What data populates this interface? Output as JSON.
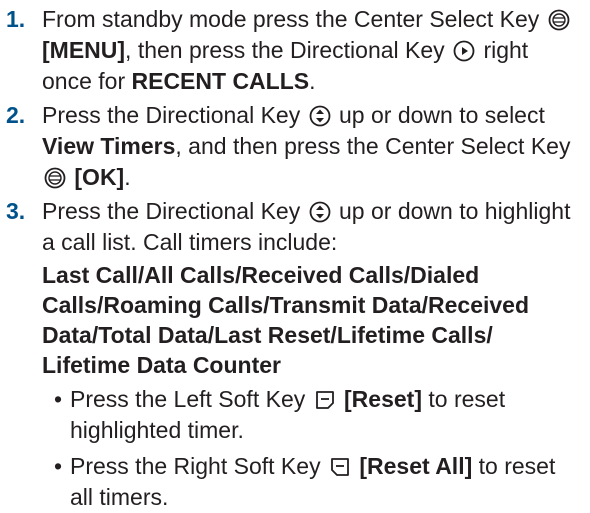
{
  "steps": [
    {
      "number": "1.",
      "t1": "From standby mode press the Center Select Key",
      "t2": "[MENU]",
      "t3": ", then press the Directional Key",
      "t4": "right once for",
      "t5": "RECENT CALLS",
      "t6": "."
    },
    {
      "number": "2.",
      "t1": "Press the Directional Key",
      "t2": "up or down to select",
      "t3": "View Timers",
      "t4": ", and then press the Center Select Key",
      "t5": "[OK]",
      "t6": "."
    },
    {
      "number": "3.",
      "t1": "Press the Directional Key",
      "t2": "up or down to highlight a call list. Call timers include:",
      "list": "Last Call/All Calls/Received Calls/Dialed Calls/Roaming Calls/Transmit Data/Received Data/Total Data/Last Reset/Lifetime Calls/ Lifetime Data Counter",
      "bullets": [
        {
          "a": "Press the Left Soft Key",
          "b": "[Reset]",
          "c": "to reset highlighted timer."
        },
        {
          "a": "Press the Right Soft Key",
          "b": "[Reset All]",
          "c": "to reset all timers."
        }
      ]
    }
  ],
  "icons": {
    "center_select": "center-select-key-icon",
    "dir_right": "directional-right-icon",
    "dir_updown": "directional-up-down-icon",
    "left_soft": "left-soft-key-icon",
    "right_soft": "right-soft-key-icon"
  }
}
